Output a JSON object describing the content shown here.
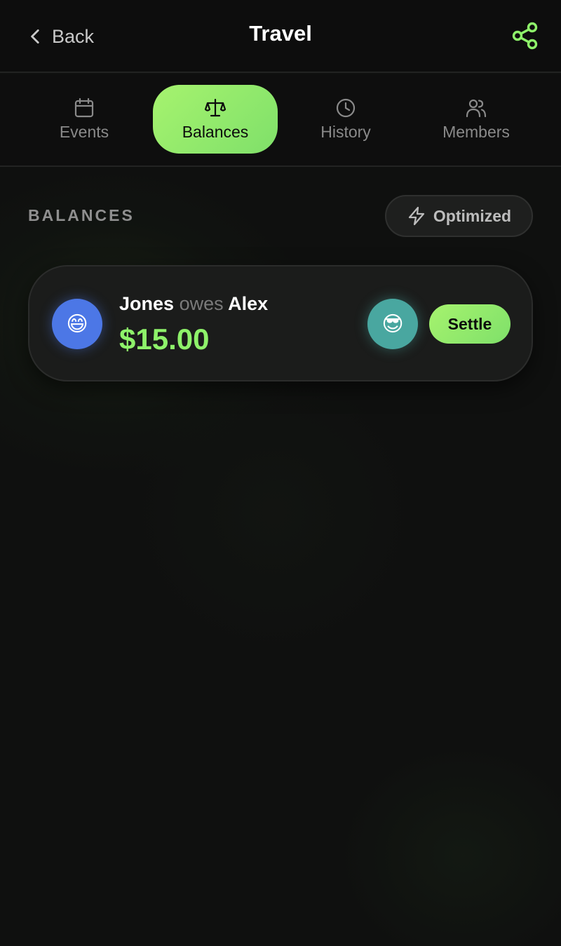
{
  "header": {
    "back_label": "Back",
    "title": "Travel",
    "share_icon": "share-icon",
    "accent_color": "#8ef26a"
  },
  "tabs": [
    {
      "label": "Events",
      "icon": "calendar-icon",
      "active": false
    },
    {
      "label": "Balances",
      "icon": "scale-icon",
      "active": true
    },
    {
      "label": "History",
      "icon": "clock-icon",
      "active": false
    },
    {
      "label": "Members",
      "icon": "users-icon",
      "active": false
    }
  ],
  "section": {
    "title": "BALANCES",
    "mode_label": "Optimized",
    "mode_icon": "lightning-icon"
  },
  "balances": [
    {
      "debtor": "Jones",
      "verb": "owes",
      "creditor": "Alex",
      "amount": "$15.00",
      "debtor_avatar": "😄",
      "creditor_avatar": "😎",
      "action_label": "Settle"
    }
  ]
}
